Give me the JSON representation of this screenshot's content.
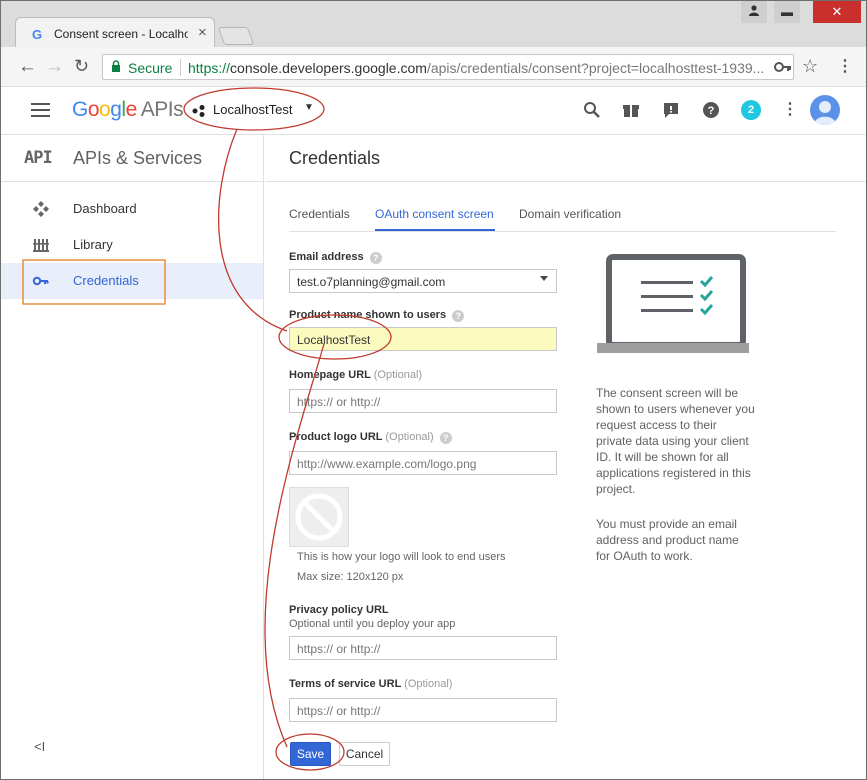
{
  "browser": {
    "tab_title": "Consent screen - Localhos",
    "tab_close": "×",
    "window_controls": {
      "minimize": "▬",
      "maximize": "⌄",
      "close": "✕"
    },
    "secure_label": "Secure",
    "url_scheme": "https://",
    "url_host": "console.developers.google.com",
    "url_path": "/apis/credentials/consent?project=localhosttest-1939..."
  },
  "appbar": {
    "logo_google": "Google",
    "logo_apis": "APIs",
    "project_name": "LocalhostTest",
    "notification_count": "2"
  },
  "sidebar": {
    "header_icon": "API",
    "title": "APIs & Services",
    "items": [
      {
        "label": "Dashboard",
        "icon": "dashboard-icon"
      },
      {
        "label": "Library",
        "icon": "library-icon"
      },
      {
        "label": "Credentials",
        "icon": "key-icon",
        "active": true
      }
    ],
    "collapse_label": "<I"
  },
  "main": {
    "title": "Credentials",
    "tabs": [
      {
        "label": "Credentials",
        "selected": false
      },
      {
        "label": "OAuth consent screen",
        "selected": true
      },
      {
        "label": "Domain verification",
        "selected": false
      }
    ],
    "form": {
      "email_label": "Email address",
      "email_value": "test.o7planning@gmail.com",
      "product_label": "Product name shown to users",
      "product_value": "LocalhostTest",
      "homepage_label": "Homepage URL",
      "optional": "(Optional)",
      "homepage_placeholder": "https:// or http://",
      "logo_label": "Product logo URL",
      "logo_placeholder": "http://www.example.com/logo.png",
      "logo_note": "This is how your logo will look to end users",
      "logo_size": "Max size: 120x120 px",
      "privacy_label": "Privacy policy URL",
      "privacy_sub": "Optional until you deploy your app",
      "privacy_placeholder": "https:// or http://",
      "tos_label": "Terms of service URL",
      "tos_placeholder": "https:// or http://",
      "save": "Save",
      "cancel": "Cancel"
    },
    "info_1": "The consent screen will be shown to users whenever you request access to their private data using your client ID. It will be shown for all applications registered in this project.",
    "info_2": "You must provide an email address and product name for OAuth to work."
  },
  "colors": {
    "accent": "#3367d6",
    "annotation_red": "#c0392b",
    "annotation_orange": "#e67e22",
    "check_teal": "#26a69a"
  }
}
